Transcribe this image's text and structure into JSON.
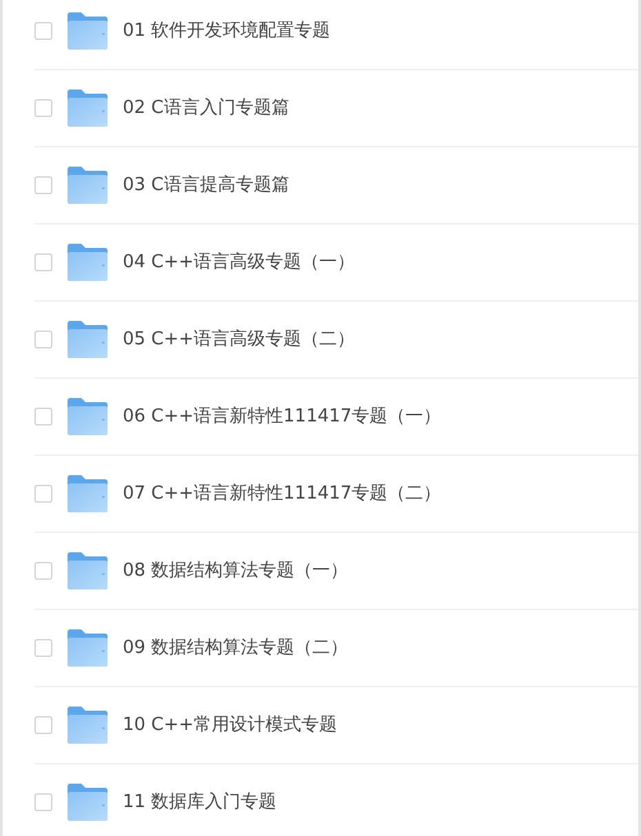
{
  "folders": [
    {
      "name": "01 软件开发环境配置专题",
      "checked": false
    },
    {
      "name": "02 C语言入门专题篇",
      "checked": false
    },
    {
      "name": "03 C语言提高专题篇",
      "checked": false
    },
    {
      "name": "04 C++语言高级专题（一）",
      "checked": false
    },
    {
      "name": "05 C++语言高级专题（二）",
      "checked": false
    },
    {
      "name": "06 C++语言新特性111417专题（一）",
      "checked": false
    },
    {
      "name": "07 C++语言新特性111417专题（二）",
      "checked": false
    },
    {
      "name": "08 数据结构算法专题（一）",
      "checked": false
    },
    {
      "name": "09 数据结构算法专题（二）",
      "checked": false
    },
    {
      "name": "10 C++常用设计模式专题",
      "checked": false
    },
    {
      "name": "11 数据库入门专题",
      "checked": false
    }
  ]
}
